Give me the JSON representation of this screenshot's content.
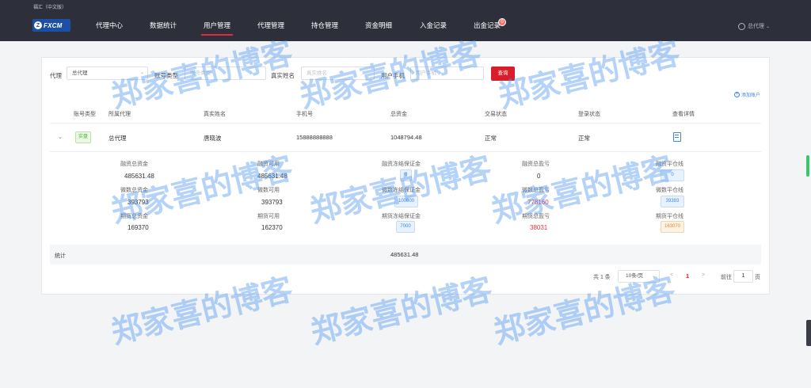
{
  "site_title": "福汇（中文版）",
  "logo_text": "FXCM",
  "logo_mark": "Z",
  "nav": [
    "代理中心",
    "数据统计",
    "用户管理",
    "代理管理",
    "持仓管理",
    "资金明细",
    "入金记录",
    "出金记录"
  ],
  "nav_badge": "0",
  "user_menu": "总代理",
  "filters": {
    "agent_label": "代理",
    "agent_value": "总代理",
    "account_type_label": "账号类型",
    "account_type_placeholder": "账号类型",
    "real_name_label": "真实姓名",
    "real_name_placeholder": "真实姓名",
    "phone_label": "用户手机",
    "phone_placeholder": "用户手机",
    "query_button": "查询"
  },
  "add_account": "添加账户",
  "table": {
    "headers": [
      "账号类型",
      "所属代理",
      "真实姓名",
      "手机号",
      "总资金",
      "交易状态",
      "登录状态",
      "查看详情"
    ],
    "row": {
      "type_tag": "实盘",
      "agent": "总代理",
      "name": "唐晓波",
      "phone": "15888888888",
      "total": "1048794.48",
      "trade_status": "正常",
      "login_status": "正常"
    }
  },
  "stats": [
    [
      {
        "label": "融资总资金",
        "value": "485631.48"
      },
      {
        "label": "融资可用",
        "value": "485631.48"
      },
      {
        "label": "融资冻结保证金",
        "value": "0"
      },
      {
        "label": "融资总盈亏",
        "value": "0"
      },
      {
        "label": "融资平仓线",
        "value": "0"
      }
    ],
    [
      {
        "label": "微数总资金",
        "value": "393793"
      },
      {
        "label": "微数可用",
        "value": "393793"
      },
      {
        "label": "微数冻结保证金",
        "value": "100000"
      },
      {
        "label": "微数总盈亏",
        "value": "778160"
      },
      {
        "label": "微数平仓线",
        "value": "39393"
      }
    ],
    [
      {
        "label": "期货总资金",
        "value": "169370"
      },
      {
        "label": "期货可用",
        "value": "162370"
      },
      {
        "label": "期货冻结保证金",
        "value": "7000"
      },
      {
        "label": "期货总盈亏",
        "value": "38031"
      },
      {
        "label": "期货平仓线",
        "value": "163070"
      }
    ]
  ],
  "summary": {
    "label": "统计",
    "value": "485631.48"
  },
  "pagination": {
    "total": "共 1 条",
    "page_size": "10条/页",
    "prev": "<",
    "current": "1",
    "next": ">",
    "goto": "前往",
    "goto_value": "1",
    "page_suffix": "页"
  },
  "watermark": "郑家喜的博客",
  "colors": {
    "nav_bg": "#2d2f3a",
    "accent_red": "#d81e2a",
    "link_blue": "#3d86e5",
    "positive_red": "#e33b3b",
    "real_tag_green": "#4fae3a"
  }
}
